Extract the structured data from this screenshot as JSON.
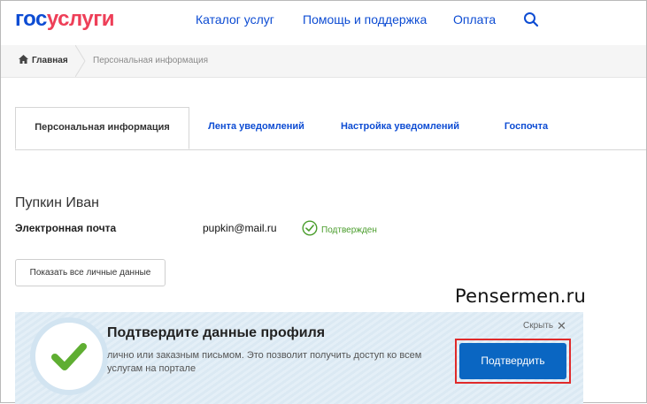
{
  "header": {
    "logo_part1": "гос",
    "logo_part2": "услуги",
    "nav": {
      "catalog": "Каталог услуг",
      "help": "Помощь и поддержка",
      "payment": "Оплата"
    },
    "search_icon": "search-icon"
  },
  "breadcrumb": {
    "home": "Главная",
    "current": "Персональная информация"
  },
  "tabs": {
    "personal": "Персональная информация",
    "feed": "Лента уведомлений",
    "notify_settings": "Настройка уведомлений",
    "post": "Госпочта",
    "active": "personal"
  },
  "profile": {
    "name": "Пупкин Иван",
    "email_label": "Электронная почта",
    "email_value": "pupkin@mail.ru",
    "email_status": "Подтвержден",
    "show_all_button": "Показать все личные данные"
  },
  "watermark": "Pensermen.ru",
  "banner": {
    "title": "Подтвердите данные профиля",
    "text": "лично или заказным письмом. Это позволит получить доступ ко всем услугам на портале",
    "hide_label": "Скрыть",
    "confirm_button": "Подтвердить"
  },
  "colors": {
    "brand_blue": "#0d4cd3",
    "brand_red": "#ee3f58",
    "confirm_button": "#0a66c2",
    "verified_green": "#4a9d2c",
    "highlight_frame": "#e02a2a"
  }
}
